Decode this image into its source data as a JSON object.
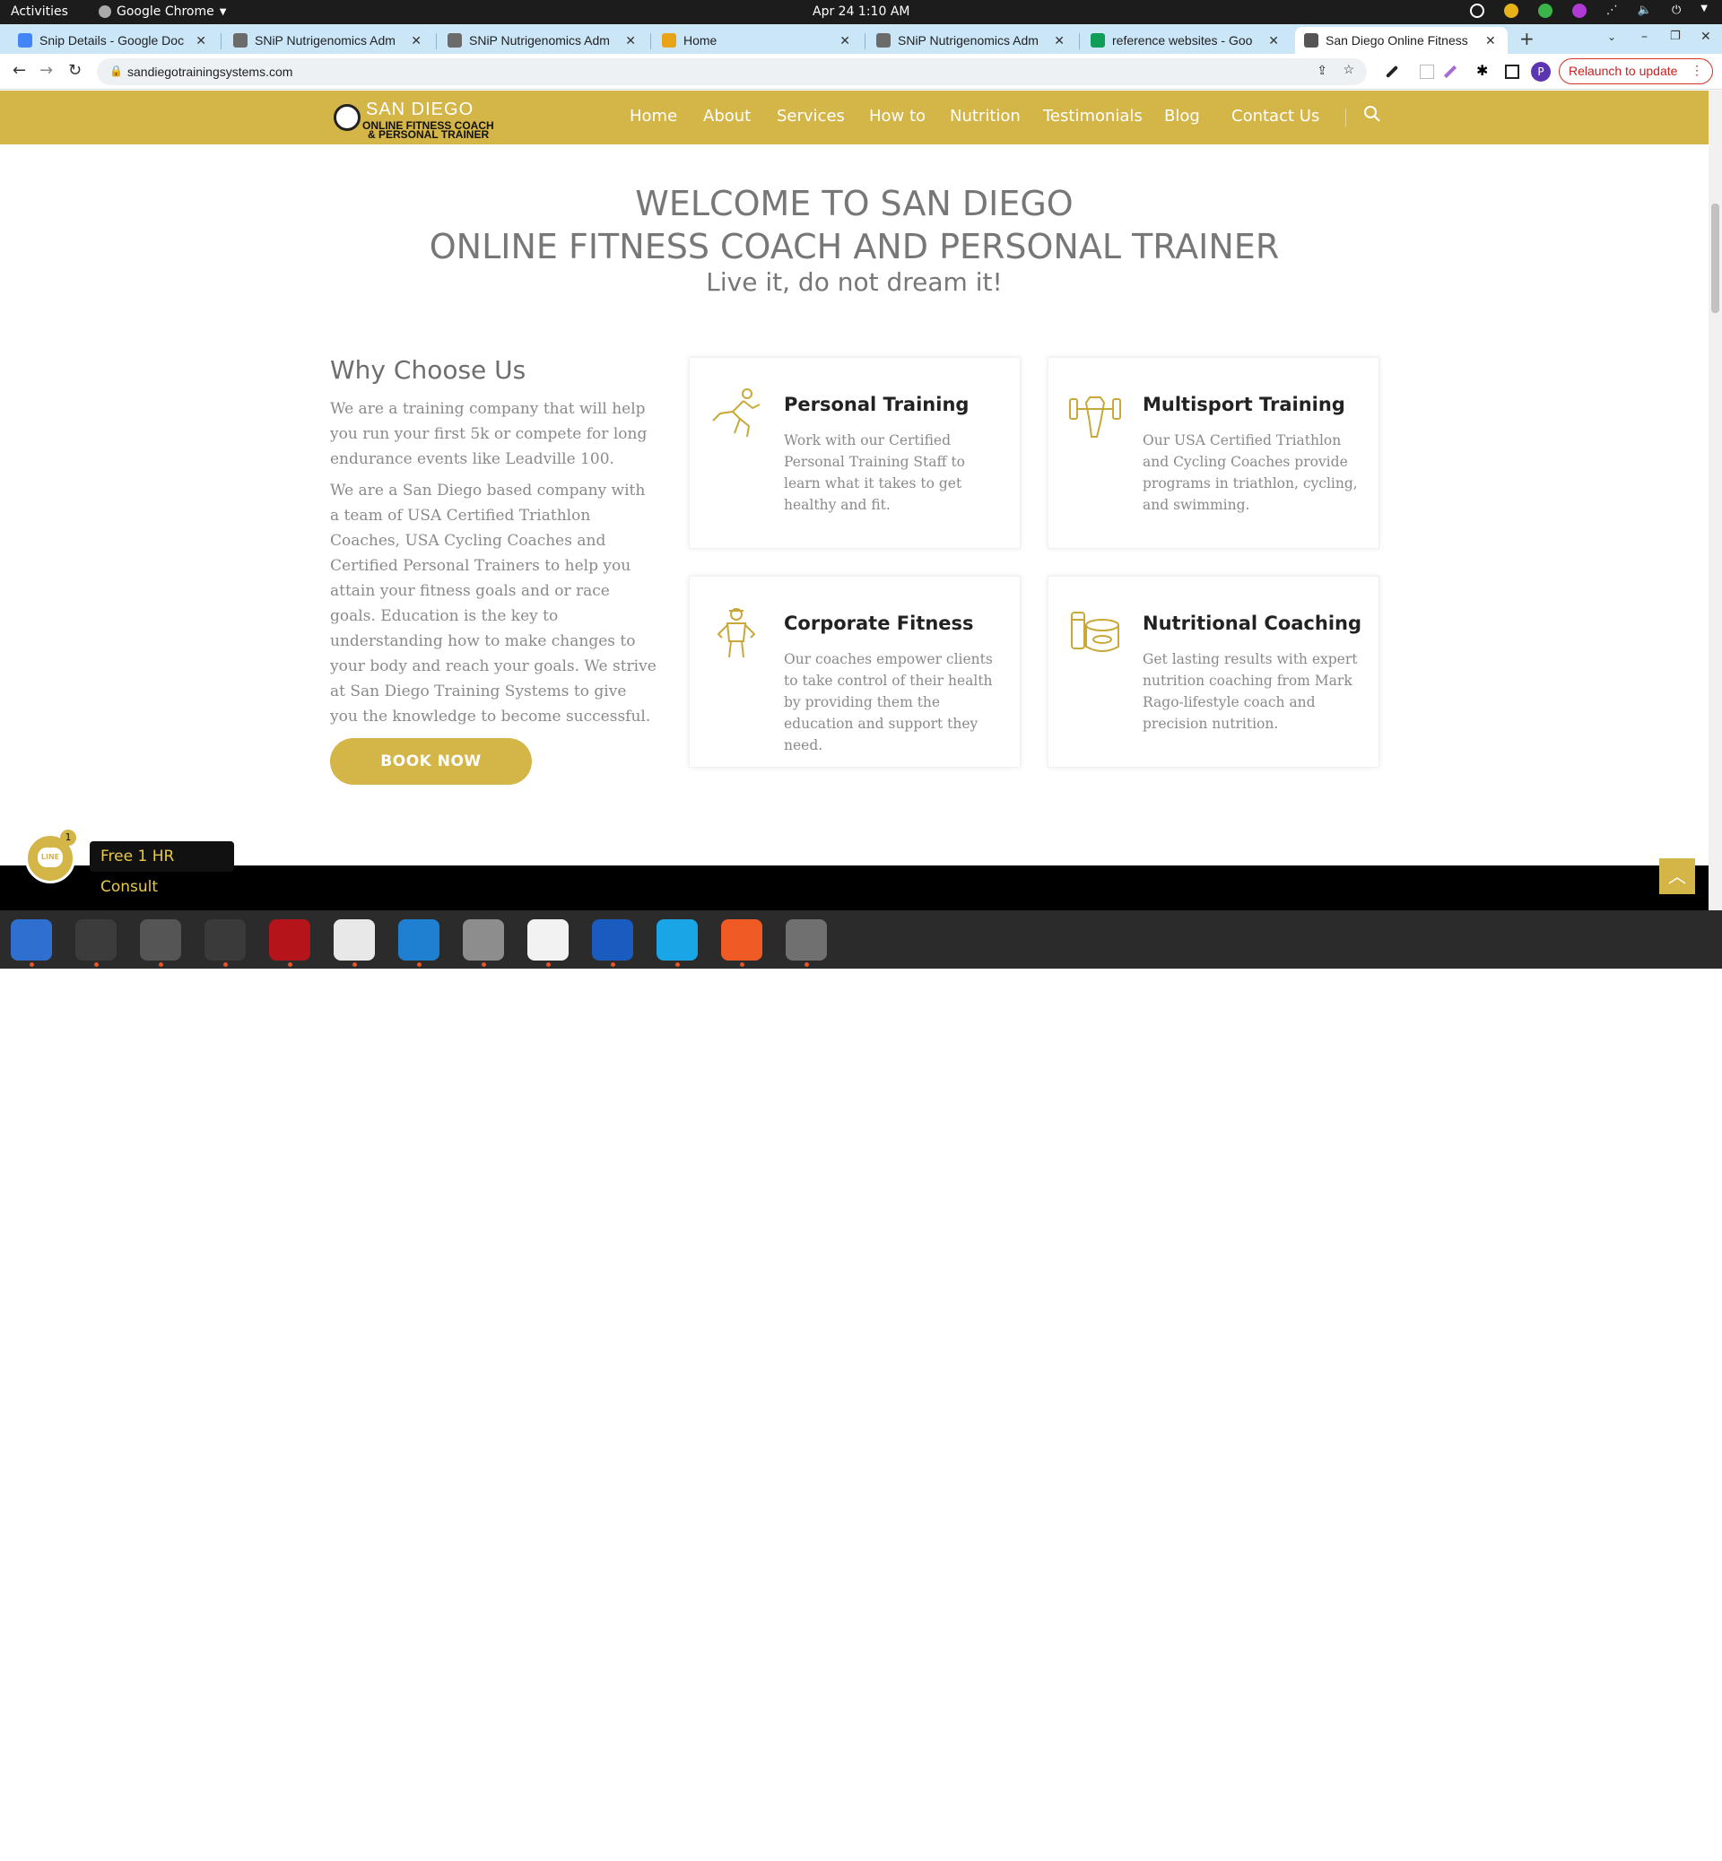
{
  "system": {
    "activities": "Activities",
    "app_name": "Google Chrome",
    "clock": "Apr 24  1:10 AM"
  },
  "tabs": [
    {
      "title": "Snip Details - Google Doc",
      "color": "#4285f4"
    },
    {
      "title": "SNiP Nutrigenomics Adm",
      "color": "#6b6b6b"
    },
    {
      "title": "SNiP Nutrigenomics Adm",
      "color": "#6b6b6b"
    },
    {
      "title": "Home",
      "color": "#e8a317"
    },
    {
      "title": "SNiP Nutrigenomics Adm",
      "color": "#6b6b6b"
    },
    {
      "title": "reference websites - Goo",
      "color": "#0f9d58"
    },
    {
      "title": "San Diego Online Fitness",
      "color": "#555555"
    }
  ],
  "browser": {
    "url": "sandiegotrainingsystems.com",
    "relaunch": "Relaunch to update",
    "profile_initial": "P"
  },
  "site": {
    "logo_line1": "SAN DIEGO",
    "logo_line2": "ONLINE FITNESS COACH",
    "logo_line3": "& PERSONAL TRAINER",
    "nav": [
      "Home",
      "About",
      "Services",
      "How to",
      "Nutrition",
      "Testimonials",
      "Blog",
      "Contact Us"
    ],
    "accent": "#d4b548"
  },
  "hero": {
    "line1": "WELCOME TO SAN DIEGO",
    "line2": "ONLINE FITNESS COACH AND PERSONAL TRAINER",
    "tagline": "Live it, do not dream it!"
  },
  "why": {
    "title": "Why Choose Us",
    "p1": "We are a training company that will help you run your first 5k or compete for long endurance events like Leadville 100.",
    "p2": "We are a San Diego based company with a team of USA Certified Triathlon Coaches, USA Cycling Coaches and Certified Personal Trainers to help you attain your fitness goals and or race goals. Education is the key to understanding how to make changes to your body and reach your goals. We strive at San Diego Training Systems to give you the knowledge to become successful.",
    "button": "BOOK NOW"
  },
  "cards": [
    {
      "title": "Personal Training",
      "desc": "Work with our Certified Personal Training Staff to learn what it takes to get healthy and fit.",
      "icon": "runner-icon"
    },
    {
      "title": "Multisport Training",
      "desc": "Our USA Certified Triathlon and Cycling Coaches provide programs in triathlon, cycling, and swimming.",
      "icon": "dumbbell-icon"
    },
    {
      "title": "Corporate Fitness",
      "desc": "Our coaches empower clients to take control of their health by providing them the education and support they need.",
      "icon": "trainer-icon"
    },
    {
      "title": "Nutritional Coaching",
      "desc": "Get lasting results with expert nutrition coaching from Mark Rago-lifestyle coach and precision nutrition.",
      "icon": "nutrition-icon"
    }
  ],
  "chat": {
    "label": "Free 1 HR Consult",
    "badge": "1",
    "bubble": "LINE"
  },
  "dock": [
    {
      "name": "thunderbird-icon",
      "color": "#2f6fd0"
    },
    {
      "name": "terminal-icon",
      "color": "#3c3c3c"
    },
    {
      "name": "calculator-icon",
      "color": "#555555"
    },
    {
      "name": "system-monitor-icon",
      "color": "#3a3a3a"
    },
    {
      "name": "filezilla-icon",
      "color": "#b4141a"
    },
    {
      "name": "chrome-icon",
      "color": "#e8e8e8"
    },
    {
      "name": "vscode-icon",
      "color": "#1f7fd0"
    },
    {
      "name": "files-icon",
      "color": "#8d8d8d"
    },
    {
      "name": "text-editor-icon",
      "color": "#f2f2f2"
    },
    {
      "name": "document-viewer-icon",
      "color": "#1a5bbf"
    },
    {
      "name": "skype-icon",
      "color": "#1aa5e6"
    },
    {
      "name": "inkscape-icon",
      "color": "#f05a24"
    },
    {
      "name": "disk-utility-icon",
      "color": "#707070"
    }
  ]
}
